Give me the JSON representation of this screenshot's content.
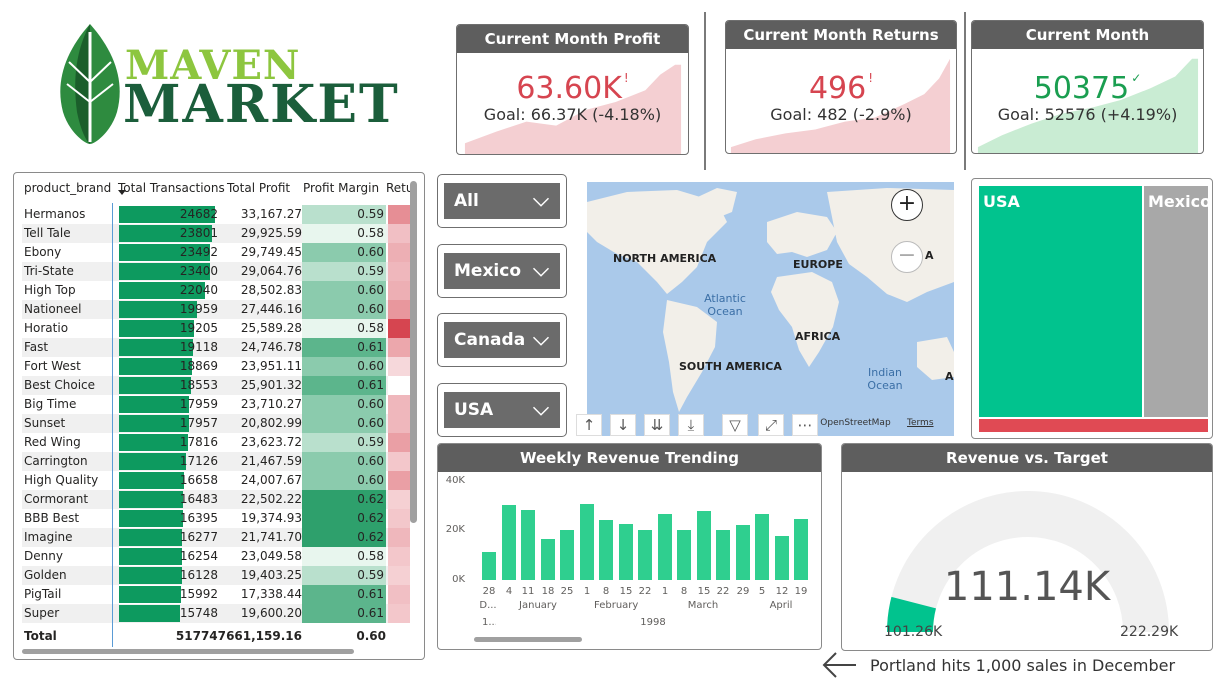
{
  "logo": {
    "line1": "MAVEN",
    "line2": "MARKET"
  },
  "kpis": [
    {
      "title": "Current Month Profit",
      "value": "63.60K",
      "mark": "!",
      "goal": "Goal: 66.37K (-4.18%)",
      "value_color": "#d64550",
      "spark_color": "#f4cfd2",
      "status": "below"
    },
    {
      "title": "Current Month Returns",
      "value": "496",
      "mark": "!",
      "goal": "Goal: 482 (-2.9%)",
      "value_color": "#d64550",
      "spark_color": "#f4cfd2",
      "status": "below"
    },
    {
      "title": "Current Month Transactions",
      "value": "50375",
      "mark": "✓",
      "goal": "Goal: 52576 (+4.19%)",
      "value_color": "#1a9e50",
      "spark_color": "#c9ecd3",
      "status": "above"
    }
  ],
  "table": {
    "columns": [
      "product_brand",
      "Total Transactions",
      "Total Profit",
      "Profit Margin",
      "Retu"
    ],
    "max_transactions": 24682,
    "rows": [
      {
        "brand": "Hermanos",
        "transactions": 24682,
        "profit": "33,167.27",
        "margin": "0.59",
        "ret": 0.55
      },
      {
        "brand": "Tell Tale",
        "transactions": 23801,
        "profit": "29,925.59",
        "margin": "0.58",
        "ret": 0.25
      },
      {
        "brand": "Ebony",
        "transactions": 23492,
        "profit": "29,749.45",
        "margin": "0.60",
        "ret": 0.35
      },
      {
        "brand": "Tri-State",
        "transactions": 23400,
        "profit": "29,064.76",
        "margin": "0.59",
        "ret": 0.3
      },
      {
        "brand": "High Top",
        "transactions": 22040,
        "profit": "28,502.83",
        "margin": "0.60",
        "ret": 0.35
      },
      {
        "brand": "Nationeel",
        "transactions": 19959,
        "profit": "27,446.16",
        "margin": "0.60",
        "ret": 0.5
      },
      {
        "brand": "Horatio",
        "transactions": 19205,
        "profit": "25,589.28",
        "margin": "0.58",
        "ret": 1.0
      },
      {
        "brand": "Fast",
        "transactions": 19118,
        "profit": "24,746.78",
        "margin": "0.61",
        "ret": 0.4
      },
      {
        "brand": "Fort West",
        "transactions": 18869,
        "profit": "23,951.11",
        "margin": "0.60",
        "ret": 0.1
      },
      {
        "brand": "Best Choice",
        "transactions": 18553,
        "profit": "25,901.32",
        "margin": "0.61",
        "ret": 0.0
      },
      {
        "brand": "Big Time",
        "transactions": 17959,
        "profit": "23,710.27",
        "margin": "0.60",
        "ret": 0.3
      },
      {
        "brand": "Sunset",
        "transactions": 17957,
        "profit": "20,802.99",
        "margin": "0.60",
        "ret": 0.3
      },
      {
        "brand": "Red Wing",
        "transactions": 17816,
        "profit": "23,623.72",
        "margin": "0.59",
        "ret": 0.45
      },
      {
        "brand": "Carrington",
        "transactions": 17126,
        "profit": "21,467.59",
        "margin": "0.60",
        "ret": 0.2
      },
      {
        "brand": "High Quality",
        "transactions": 16658,
        "profit": "24,007.67",
        "margin": "0.60",
        "ret": 0.45
      },
      {
        "brand": "Cormorant",
        "transactions": 16483,
        "profit": "22,502.22",
        "margin": "0.62",
        "ret": 0.15
      },
      {
        "brand": "BBB Best",
        "transactions": 16395,
        "profit": "19,374.93",
        "margin": "0.62",
        "ret": 0.2
      },
      {
        "brand": "Imagine",
        "transactions": 16277,
        "profit": "21,741.70",
        "margin": "0.62",
        "ret": 0.3
      },
      {
        "brand": "Denny",
        "transactions": 16254,
        "profit": "23,049.58",
        "margin": "0.58",
        "ret": 0.2
      },
      {
        "brand": "Golden",
        "transactions": 16128,
        "profit": "19,403.25",
        "margin": "0.59",
        "ret": 0.15
      },
      {
        "brand": "PigTail",
        "transactions": 15992,
        "profit": "17,338.44",
        "margin": "0.61",
        "ret": 0.25
      },
      {
        "brand": "Super",
        "transactions": 15748,
        "profit": "19,600.20",
        "margin": "0.61",
        "ret": 0.2
      }
    ],
    "total": {
      "label": "Total",
      "transactions": "517747",
      "profit": "661,159.16",
      "margin": "0.60"
    }
  },
  "slicers": [
    "All",
    "Mexico",
    "Canada",
    "USA"
  ],
  "map": {
    "labels": [
      "NORTH AMERICA",
      "EUROPE",
      "AFRICA",
      "SOUTH AMERICA",
      "A",
      "AS"
    ],
    "water": [
      "Atlantic Ocean",
      "Indian Ocean"
    ],
    "zoom_in": "+",
    "zoom_out": "−",
    "attribution": "n, © OpenStreetMap",
    "terms": "Terms",
    "land_color": "#f2efe9",
    "water_color": "#aac9ea"
  },
  "treemap": {
    "items": [
      {
        "label": "USA",
        "color": "#01c38e"
      },
      {
        "label": "Mexico",
        "color": "#a8a8a8"
      }
    ],
    "bottom_color": "#e04a54"
  },
  "weekly_chart": {
    "title": "Weekly Revenue Trending",
    "y_ticks": [
      "40K",
      "20K",
      "0K"
    ],
    "year": "1998",
    "months": [
      "January",
      "February",
      "March",
      "April"
    ],
    "partial_labels": [
      "D...",
      "1..."
    ],
    "chart_data": {
      "type": "bar",
      "categories": [
        "28",
        "4",
        "11",
        "18",
        "25",
        "1",
        "8",
        "15",
        "22",
        "1",
        "8",
        "15",
        "22",
        "29",
        "5",
        "12",
        "19"
      ],
      "values": [
        11000,
        30000,
        28000,
        16500,
        20000,
        30500,
        24000,
        22500,
        20000,
        26500,
        20000,
        27500,
        20000,
        22000,
        26500,
        17500,
        24500
      ],
      "ylim": [
        0,
        40000
      ]
    }
  },
  "gauge": {
    "title": "Revenue vs. Target",
    "value": "111.14K",
    "min": "101.26K",
    "max": "222.29K",
    "fill_fraction": 0.08,
    "fill_color": "#01c38e",
    "track_color": "#f0f0f0"
  },
  "note": {
    "text": "Portland hits 1,000 sales in December"
  }
}
